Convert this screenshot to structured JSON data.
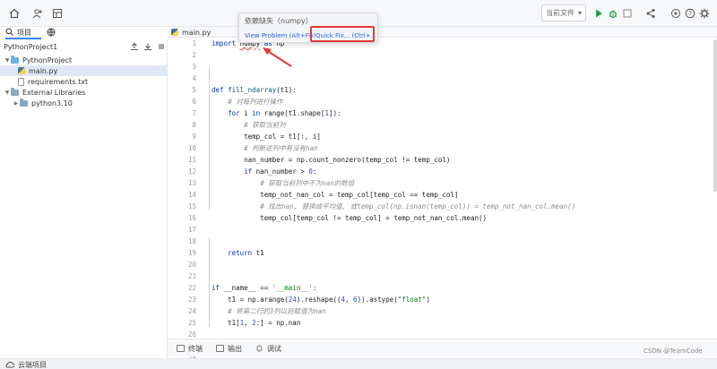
{
  "toolbar": {
    "run_config_label": "当前文件",
    "icons": [
      "home-icon",
      "add-user-icon",
      "table-icon",
      "run-icon",
      "debug-icon",
      "stop-icon",
      "share-icon",
      "settings-icon",
      "help-icon",
      "gear-icon"
    ]
  },
  "sidebar": {
    "tabs": [
      {
        "label": "项目"
      },
      {
        "label": ""
      }
    ],
    "project_name": "PythonProject1",
    "tree": [
      {
        "label": "PythonProject",
        "type": "folder"
      },
      {
        "label": "main.py",
        "type": "py"
      },
      {
        "label": "requirements.txt",
        "type": "txt"
      },
      {
        "label": "External Libraries",
        "type": "lib"
      },
      {
        "label": "python3.10",
        "type": "lib"
      }
    ]
  },
  "editor": {
    "tab_label": "main.py",
    "line_numbers": [
      "1",
      "2",
      "3",
      "4",
      "5",
      "6",
      "7",
      "8",
      "9",
      "10",
      "11",
      "12",
      "13",
      "14",
      "15",
      "16",
      "17",
      "18",
      "19",
      "20",
      "21",
      "22",
      "23",
      "24",
      "25",
      "26",
      "27",
      "28"
    ]
  },
  "popup": {
    "title": "依赖缺失（numpy）",
    "view_problem": "View Problem (Alt+F8)",
    "quick_fix": "Quick Fix... (Ctrl+.)"
  },
  "bottom_tools": {
    "terminal": "终端",
    "output": "输出",
    "debug": "调试"
  },
  "statusbar": {
    "cloud_project": "云端项目"
  },
  "watermark": "CSDN @TeamCode",
  "colors": {
    "accent": "#3b82f6",
    "highlight": "#e53935",
    "run_green": "#22a34a"
  }
}
